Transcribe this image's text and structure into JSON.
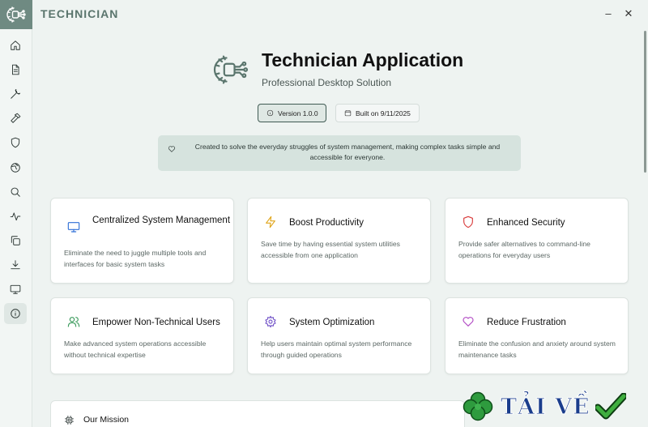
{
  "app": {
    "title": "TECHNICIAN",
    "window_controls": {
      "minimize": "–",
      "close": "✕"
    }
  },
  "sidebar": {
    "items": [
      {
        "name": "home",
        "icon": "home-icon"
      },
      {
        "name": "documents",
        "icon": "document-icon"
      },
      {
        "name": "tools",
        "icon": "wrench-icon"
      },
      {
        "name": "build",
        "icon": "hammer-icon"
      },
      {
        "name": "security",
        "icon": "shield-icon"
      },
      {
        "name": "network",
        "icon": "globe-icon"
      },
      {
        "name": "search",
        "icon": "search-icon"
      },
      {
        "name": "activity",
        "icon": "activity-icon"
      },
      {
        "name": "copy",
        "icon": "copy-icon"
      },
      {
        "name": "download",
        "icon": "download-icon"
      },
      {
        "name": "display",
        "icon": "monitor-icon"
      },
      {
        "name": "about",
        "icon": "info-icon",
        "active": true
      }
    ]
  },
  "hero": {
    "title": "Technician Application",
    "subtitle": "Professional Desktop Solution",
    "version_label": "Version 1.0.0",
    "built_label": "Built on 9/11/2025"
  },
  "banner": {
    "text": "Created to solve the everyday struggles of system management, making complex tasks simple and accessible for everyone."
  },
  "cards": [
    {
      "title": "Centralized System Management",
      "desc": "Eliminate the need to juggle multiple tools and interfaces for basic system tasks",
      "icon": "monitor-icon",
      "color": "#2f6fd6"
    },
    {
      "title": "Boost Productivity",
      "desc": "Save time by having essential system utilities accessible from one application",
      "icon": "lightning-icon",
      "color": "#e0a51a"
    },
    {
      "title": "Enhanced Security",
      "desc": "Provide safer alternatives to command-line operations for everyday users",
      "icon": "shield-icon",
      "color": "#d93b3b"
    },
    {
      "title": "Empower Non-Technical Users",
      "desc": "Make advanced system operations accessible without technical expertise",
      "icon": "users-icon",
      "color": "#3a9a5b"
    },
    {
      "title": "System Optimization",
      "desc": "Help users maintain optimal system performance through guided operations",
      "icon": "gear-icon",
      "color": "#7557c9"
    },
    {
      "title": "Reduce Frustration",
      "desc": "Eliminate the confusion and anxiety around system maintenance tasks",
      "icon": "heart-icon",
      "color": "#b24bc4"
    }
  ],
  "mission": {
    "title": "Our Mission"
  },
  "watermark": {
    "text": "TẢI VỀ"
  },
  "colors": {
    "accent": "#5a756d",
    "sidebar_logo_bg": "#6f8a82",
    "banner_bg": "#d6e3de"
  }
}
